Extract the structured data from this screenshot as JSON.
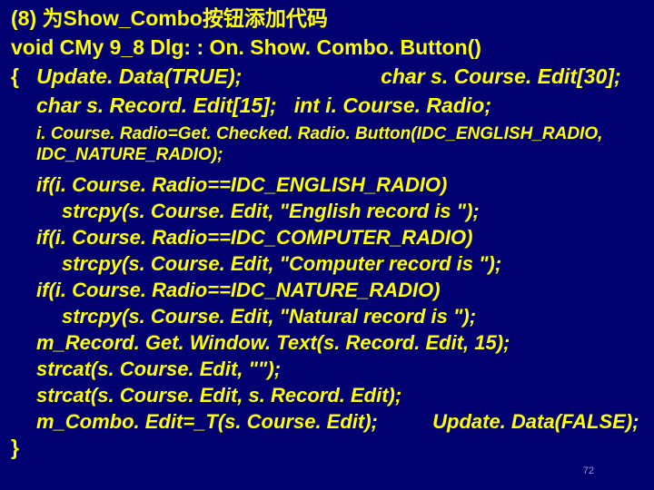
{
  "title": "(8) 为Show_Combo按钮添加代码",
  "sig": "void CMy 9_8 Dlg: : On. Show. Combo. Button()",
  "decl_open": "{",
  "decl_a": "Update. Data(TRUE);",
  "decl_b": "char s. Course. Edit[30];",
  "decl_c": "char s. Record. Edit[15];",
  "decl_d": "int i. Course. Radio;",
  "small": "i. Course. Radio=Get. Checked. Radio. Button(IDC_ENGLISH_RADIO, IDC_NATURE_RADIO);",
  "l1": "if(i. Course. Radio==IDC_ENGLISH_RADIO)",
  "l2": "strcpy(s. Course. Edit, \"English record is \");",
  "l3": "if(i. Course. Radio==IDC_COMPUTER_RADIO)",
  "l4": "strcpy(s. Course. Edit, \"Computer record is \");",
  "l5": "if(i. Course. Radio==IDC_NATURE_RADIO)",
  "l6": "strcpy(s. Course. Edit, \"Natural record is \");",
  "l7": "m_Record. Get. Window. Text(s. Record. Edit, 15);",
  "l8": "strcat(s. Course. Edit, \"\");",
  "l9": "strcat(s. Course. Edit, s. Record. Edit);",
  "l10a": "m_Combo. Edit=_T(s. Course. Edit);",
  "l10b": "Update. Data(FALSE);",
  "close": "}",
  "page": "72"
}
